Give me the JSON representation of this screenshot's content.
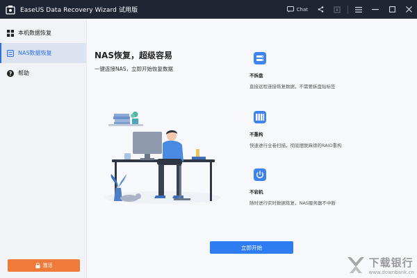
{
  "window": {
    "title": "EaseUS Data Recovery Wizard 试用版",
    "chat_label": "Chat"
  },
  "sidebar": {
    "items": [
      {
        "label": "本机数据恢复",
        "icon": "grid-icon",
        "active": false
      },
      {
        "label": "NAS数据恢复",
        "icon": "nas-icon",
        "active": true
      },
      {
        "label": "帮助",
        "icon": "help-icon",
        "active": false
      }
    ],
    "trial_button_label": "激活"
  },
  "main": {
    "headline": "NAS恢复，超级容易",
    "subline": "一键连接NAS，立即开始恢复数据",
    "features": [
      {
        "title": "不拆盘",
        "desc": "直接远程连接恢复数据，不需要拆盘贴标签",
        "icon": "nas-drive-icon"
      },
      {
        "title": "不重构",
        "desc": "快速进行全卷扫描，彻底摆脱麻烦的RAID重构",
        "icon": "raid-icon"
      },
      {
        "title": "不宕机",
        "desc": "随时进行实时数据恢复，NAS服务器不中断",
        "icon": "power-icon"
      }
    ],
    "start_button_label": "立即开始"
  },
  "watermark": {
    "cn": "下载银行",
    "url": "www.downbank.cn"
  },
  "colors": {
    "titlebar": "#1f2633",
    "accent": "#2f7bf2",
    "trial": "#f07a3a",
    "sidebar_bg": "#f1f3f7",
    "main_bg": "#f7f8fb"
  }
}
